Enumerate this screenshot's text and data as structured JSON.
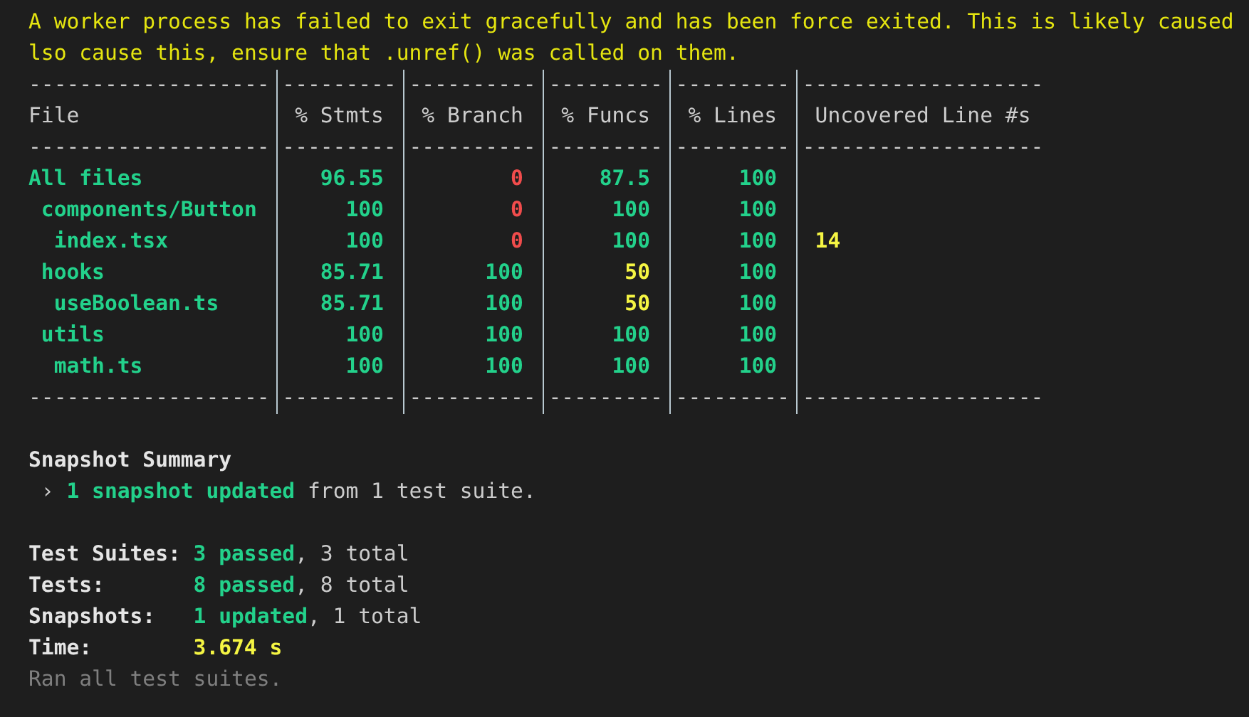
{
  "warning": [
    "A worker process has failed to exit gracefully and has been force exited. This is likely caused",
    "lso cause this, ensure that .unref() was called on them."
  ],
  "table": {
    "top_rule": [
      "-------------------",
      "---------",
      "----------",
      "---------",
      "---------",
      "-------------------"
    ],
    "columns": [
      "File",
      "% Stmts",
      "% Branch",
      "% Funcs",
      "% Lines",
      "Uncovered Line #s"
    ],
    "header_rule": [
      "-------------------",
      "---------",
      "----------",
      "---------",
      "---------",
      "-------------------"
    ],
    "rows": [
      {
        "name": "All files",
        "values": [
          {
            "text": "96.55",
            "color": "#23d18b"
          },
          {
            "text": "0",
            "color": "#f14c4c"
          },
          {
            "text": "87.5",
            "color": "#23d18b"
          },
          {
            "text": "100",
            "color": "#23d18b"
          }
        ],
        "children": [
          {
            "name": "components/Button",
            "values": [
              {
                "text": "100",
                "color": "#23d18b"
              },
              {
                "text": "0",
                "color": "#f14c4c"
              },
              {
                "text": "100",
                "color": "#23d18b"
              },
              {
                "text": "100",
                "color": "#23d18b"
              }
            ],
            "children": [
              {
                "name": "index.tsx",
                "values": [
                  {
                    "text": "100",
                    "color": "#23d18b"
                  },
                  {
                    "text": "0",
                    "color": "#f14c4c"
                  },
                  {
                    "text": "100",
                    "color": "#23d18b"
                  },
                  {
                    "text": "100",
                    "color": "#23d18b"
                  }
                ],
                "uncovered": {
                  "text": "14",
                  "color": "#f5f543"
                }
              }
            ]
          },
          {
            "name": "hooks",
            "values": [
              {
                "text": "85.71",
                "color": "#23d18b"
              },
              {
                "text": "100",
                "color": "#23d18b"
              },
              {
                "text": "50",
                "color": "#f5f543"
              },
              {
                "text": "100",
                "color": "#23d18b"
              }
            ],
            "children": [
              {
                "name": "useBoolean.ts",
                "values": [
                  {
                    "text": "85.71",
                    "color": "#23d18b"
                  },
                  {
                    "text": "100",
                    "color": "#23d18b"
                  },
                  {
                    "text": "50",
                    "color": "#f5f543"
                  },
                  {
                    "text": "100",
                    "color": "#23d18b"
                  }
                ]
              }
            ]
          },
          {
            "name": "utils",
            "values": [
              {
                "text": "100",
                "color": "#23d18b"
              },
              {
                "text": "100",
                "color": "#23d18b"
              },
              {
                "text": "100",
                "color": "#23d18b"
              },
              {
                "text": "100",
                "color": "#23d18b"
              }
            ],
            "children": [
              {
                "name": "math.ts",
                "values": [
                  {
                    "text": "100",
                    "color": "#23d18b"
                  },
                  {
                    "text": "100",
                    "color": "#23d18b"
                  },
                  {
                    "text": "100",
                    "color": "#23d18b"
                  },
                  {
                    "text": "100",
                    "color": "#23d18b"
                  }
                ]
              }
            ]
          }
        ]
      }
    ],
    "bottom_rule": [
      "-------------------",
      "---------",
      "----------",
      "---------",
      "---------",
      "-------------------"
    ]
  },
  "snapshot_summary": {
    "title": "Snapshot Summary",
    "line": "› **1 snapshot updated** from 1 test suite."
  },
  "stats": [
    {
      "label": "Test Suites:",
      "value": "**3 passed**, 3 total",
      "kind": "count"
    },
    {
      "label": "Tests:",
      "value": "**8 passed**, 8 total",
      "kind": "count"
    },
    {
      "label": "Snapshots:",
      "value": "**1 updated**, 1 total",
      "kind": "count"
    },
    {
      "label": "Time:",
      "value": "3.674 s",
      "kind": "time"
    }
  ],
  "footer": "Ran all test suites."
}
